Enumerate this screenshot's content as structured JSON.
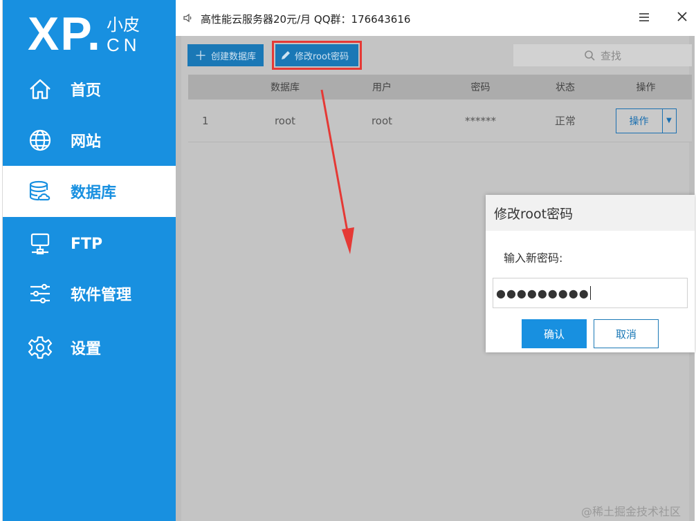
{
  "logo": {
    "main": "XP.",
    "sub": "小皮",
    "domain": "CN"
  },
  "sidebar": {
    "items": [
      {
        "label": "首页",
        "icon": "home-icon",
        "active": false
      },
      {
        "label": "网站",
        "icon": "globe-icon",
        "active": false
      },
      {
        "label": "数据库",
        "icon": "database-icon",
        "active": true
      },
      {
        "label": "FTP",
        "icon": "ftp-server-icon",
        "active": false
      },
      {
        "label": "软件管理",
        "icon": "sliders-icon",
        "active": false
      },
      {
        "label": "设置",
        "icon": "gear-icon",
        "active": false
      }
    ]
  },
  "titlebar": {
    "title": "高性能云服务器20元/月 QQ群：176643616"
  },
  "toolbar": {
    "create_label": "创建数据库",
    "change_password_label": "修改root密码",
    "search_label": "查找"
  },
  "table": {
    "headers": [
      "",
      "数据库",
      "用户",
      "密码",
      "状态",
      "操作"
    ],
    "rows": [
      {
        "index": "1",
        "database": "root",
        "user": "root",
        "password": "******",
        "status": "正常",
        "action": "操作"
      }
    ]
  },
  "modal": {
    "title": "修改root密码",
    "label": "输入新密码:",
    "value": "●●●●●●●●●",
    "ok_label": "确认",
    "cancel_label": "取消"
  },
  "colors": {
    "accent": "#1890e0",
    "highlight": "#e53935"
  },
  "watermark": "@稀土掘金技术社区"
}
